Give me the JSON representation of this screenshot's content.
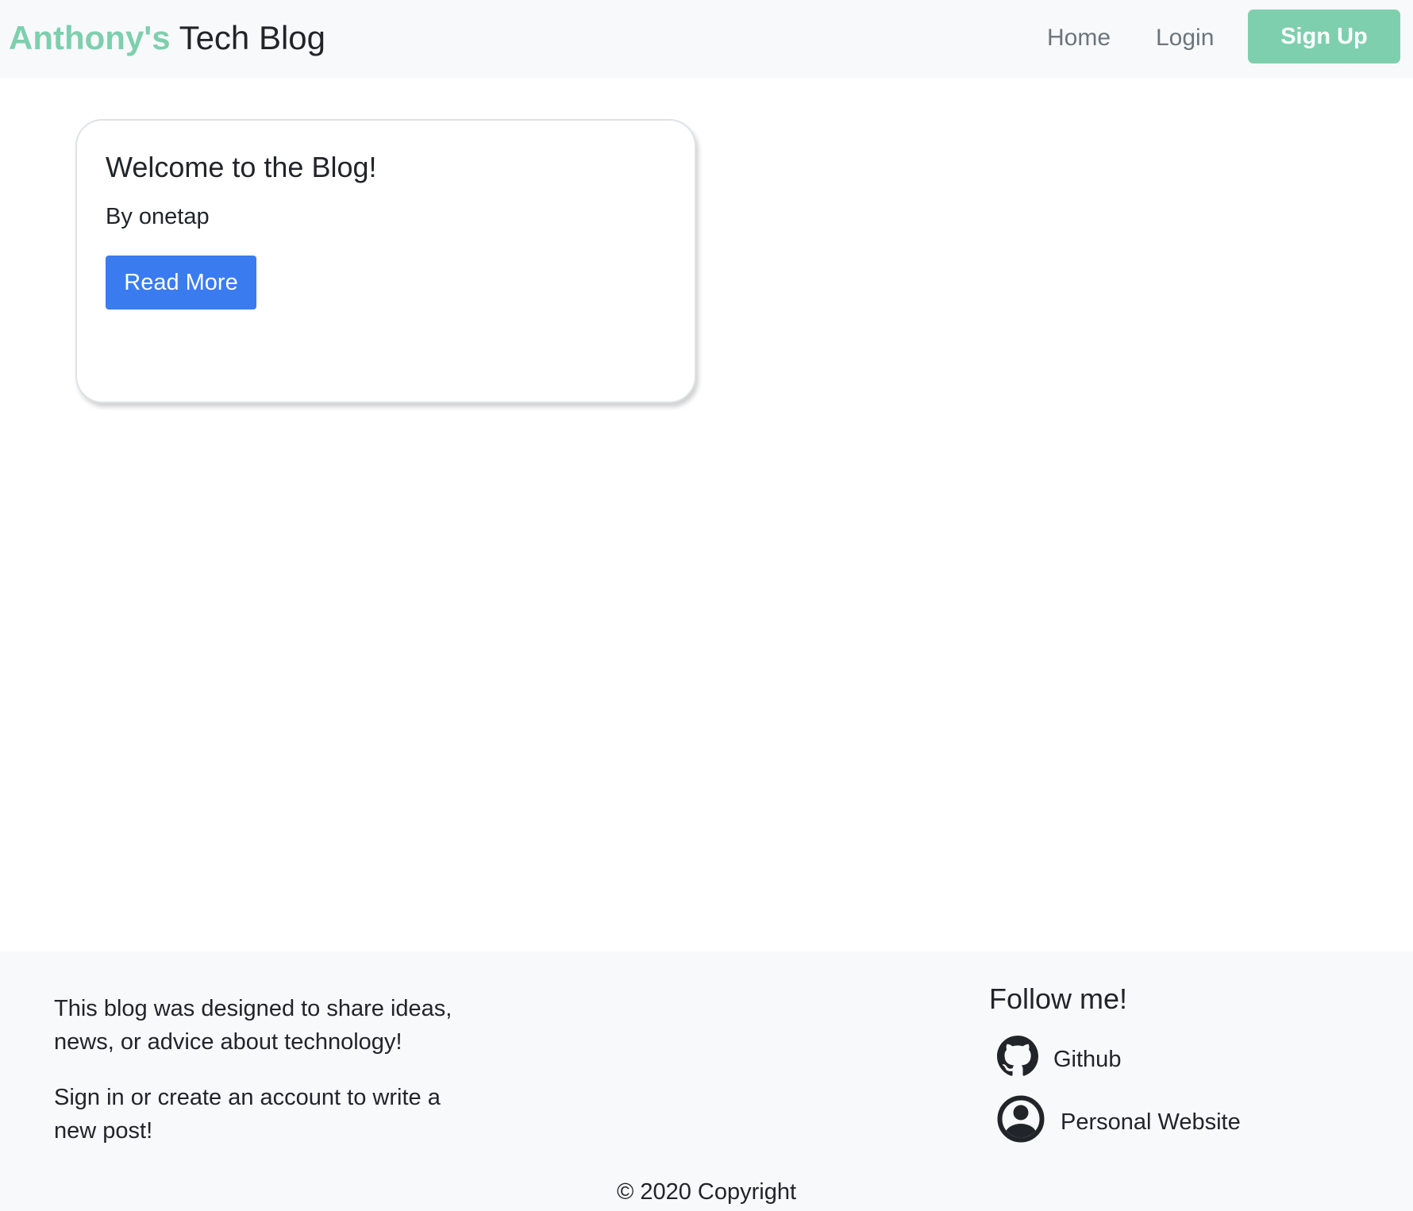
{
  "navbar": {
    "brand_accent": "Anthony's",
    "brand_rest": " Tech Blog",
    "links": [
      "Home",
      "Login"
    ],
    "signup_label": "Sign Up"
  },
  "posts": [
    {
      "title": "Welcome to the Blog!",
      "author": "By onetap",
      "button_label": "Read More"
    }
  ],
  "footer": {
    "about_paragraphs": [
      "This blog was designed to share ideas, news, or advice about technology!",
      "Sign in or create an account to write a new post!"
    ],
    "follow_title": "Follow me!",
    "social_links": [
      {
        "label": "Github",
        "icon": "github-icon"
      },
      {
        "label": "Personal Website",
        "icon": "user-circle-icon"
      }
    ],
    "copyright": "© 2020 Copyright"
  },
  "colors": {
    "accent": "#7ecfae",
    "primary_button": "#3a7bef",
    "navbar_bg": "#f8f9fa",
    "text": "#212529",
    "muted": "#6c757d"
  }
}
